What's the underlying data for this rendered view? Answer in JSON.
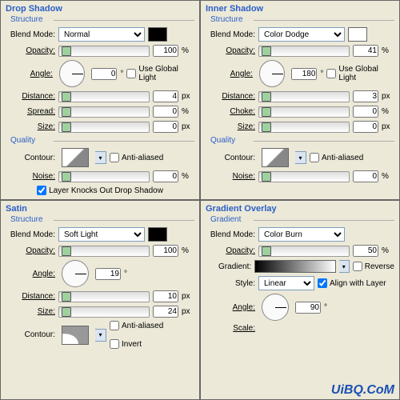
{
  "dropShadow": {
    "title": "Drop Shadow",
    "section": "Structure",
    "quality": "Quality",
    "blendModeLbl": "Blend Mode:",
    "blendMode": "Normal",
    "swatch": "#000000",
    "opacityLbl": "Opacity:",
    "opacity": "100",
    "pct": "%",
    "angleLbl": "Angle:",
    "angle": "0",
    "deg": "°",
    "useGlobal": "Use Global Light",
    "distanceLbl": "Distance:",
    "distance": "4",
    "px": "px",
    "spreadLbl": "Spread:",
    "spread": "0",
    "sizeLbl": "Size:",
    "size": "0",
    "contourLbl": "Contour:",
    "antiAliased": "Anti-aliased",
    "noiseLbl": "Noise:",
    "noise": "0",
    "knockOut": "Layer Knocks Out Drop Shadow"
  },
  "innerShadow": {
    "title": "Inner Shadow",
    "section": "Structure",
    "quality": "Quality",
    "blendModeLbl": "Blend Mode:",
    "blendMode": "Color Dodge",
    "swatch": "#ffffff",
    "opacityLbl": "Opacity:",
    "opacity": "41",
    "pct": "%",
    "angleLbl": "Angle:",
    "angle": "180",
    "deg": "°",
    "useGlobal": "Use Global Light",
    "distanceLbl": "Distance:",
    "distance": "3",
    "px": "px",
    "chokeLbl": "Choke:",
    "choke": "0",
    "sizeLbl": "Size:",
    "size": "0",
    "contourLbl": "Contour:",
    "antiAliased": "Anti-aliased",
    "noiseLbl": "Noise:",
    "noise": "0"
  },
  "satin": {
    "title": "Satin",
    "section": "Structure",
    "blendModeLbl": "Blend Mode:",
    "blendMode": "Soft Light",
    "swatch": "#000000",
    "opacityLbl": "Opacity:",
    "opacity": "100",
    "pct": "%",
    "angleLbl": "Angle:",
    "angle": "19",
    "deg": "°",
    "distanceLbl": "Distance:",
    "distance": "10",
    "px": "px",
    "sizeLbl": "Size:",
    "size": "24",
    "contourLbl": "Contour:",
    "antiAliased": "Anti-aliased",
    "invert": "Invert"
  },
  "gradientOverlay": {
    "title": "Gradient Overlay",
    "section": "Gradient",
    "blendModeLbl": "Blend Mode:",
    "blendMode": "Color Burn",
    "opacityLbl": "Opacity:",
    "opacity": "50",
    "pct": "%",
    "gradientLbl": "Gradient:",
    "reverse": "Reverse",
    "styleLbl": "Style:",
    "style": "Linear",
    "align": "Align with Layer",
    "angleLbl": "Angle:",
    "angle": "90",
    "deg": "°",
    "scaleLbl": "Scale:"
  },
  "watermark": "UiBQ.CoM"
}
